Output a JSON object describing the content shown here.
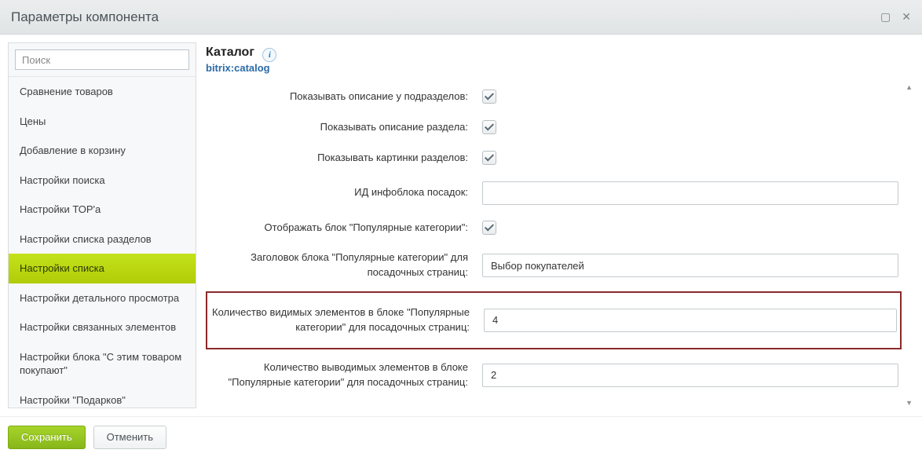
{
  "window": {
    "title": "Параметры компонента"
  },
  "sidebar": {
    "search_placeholder": "Поиск",
    "items": [
      {
        "label": "Сравнение товаров"
      },
      {
        "label": "Цены"
      },
      {
        "label": "Добавление в корзину"
      },
      {
        "label": "Настройки поиска"
      },
      {
        "label": "Настройки ТОР'а"
      },
      {
        "label": "Настройки списка разделов"
      },
      {
        "label": "Настройки списка",
        "active": true
      },
      {
        "label": "Настройки детального просмотра"
      },
      {
        "label": "Настройки связанных элементов"
      },
      {
        "label": "Настройки блока \"С этим товаром покупают\""
      },
      {
        "label": "Настройки \"Подарков\""
      }
    ]
  },
  "main": {
    "heading": "Каталог",
    "component_id": "bitrix:catalog",
    "rows": {
      "show_subsection_desc": {
        "label": "Показывать описание у подразделов:",
        "checked": true
      },
      "show_section_desc": {
        "label": "Показывать описание раздела:",
        "checked": true
      },
      "show_section_images": {
        "label": "Показывать картинки разделов:",
        "checked": true
      },
      "landing_iblock_id": {
        "label": "ИД инфоблока посадок:",
        "value": ""
      },
      "show_popular_block": {
        "label": "Отображать блок \"Популярные категории\":",
        "checked": true
      },
      "popular_title": {
        "label": "Заголовок блока \"Популярные категории\" для посадочных страниц:",
        "value": "Выбор покупателей"
      },
      "popular_visible_count": {
        "label": "Количество видимых элементов в блоке \"Популярные категории\" для посадочных страниц:",
        "value": "4"
      },
      "popular_output_count": {
        "label": "Количество выводимых элементов в блоке \"Популярные категории\" для посадочных страниц:",
        "value": "2"
      }
    }
  },
  "footer": {
    "save": "Сохранить",
    "cancel": "Отменить"
  }
}
